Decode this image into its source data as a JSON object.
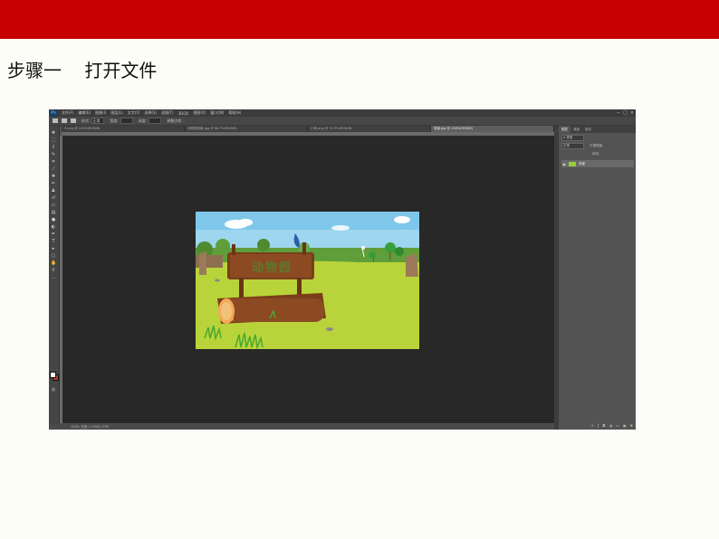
{
  "slide": {
    "title": "步骤一    打开文件",
    "accent_color": "#c70000"
  },
  "photoshop": {
    "logo": "Ps",
    "menu": [
      "文件(F)",
      "编辑(E)",
      "图像(I)",
      "图层(L)",
      "文字(Y)",
      "选择(S)",
      "滤镜(T)",
      "3D(D)",
      "视图(V)",
      "窗口(W)",
      "帮助(H)"
    ],
    "window_controls": [
      "−",
      "□",
      "×"
    ],
    "options": {
      "style_label": "样式:",
      "style_value": "正常",
      "width_label": "宽度:",
      "height_label": "高度:",
      "refine_label": "调整边缘..."
    },
    "tabs": [
      {
        "label": "3.png @ 100%(RGB/8)",
        "active": false
      },
      {
        "label": "动物园背景.jpg @ 66.7%(RGB/8)",
        "active": false
      },
      {
        "label": "小熊.png @ 33.3%(RGB/8)",
        "active": false
      },
      {
        "label": "背景.jpg @ 100%(RGB/8)",
        "active": true
      }
    ],
    "status_text": "100%   文档:1.37M/1.37M",
    "panels": {
      "tabs": [
        "图层",
        "通道",
        "路径"
      ],
      "kind_value": "ρ 类型",
      "blend_value": "正常",
      "opacity_label": "不透明度:",
      "fill_label": "填充:",
      "layer_name": "背景",
      "footer_icons": [
        "link-icon",
        "fx-icon",
        "mask-icon",
        "adjust-icon",
        "folder-icon",
        "new-layer-icon",
        "trash-icon"
      ]
    },
    "document": {
      "sign_text": "动物园"
    }
  }
}
